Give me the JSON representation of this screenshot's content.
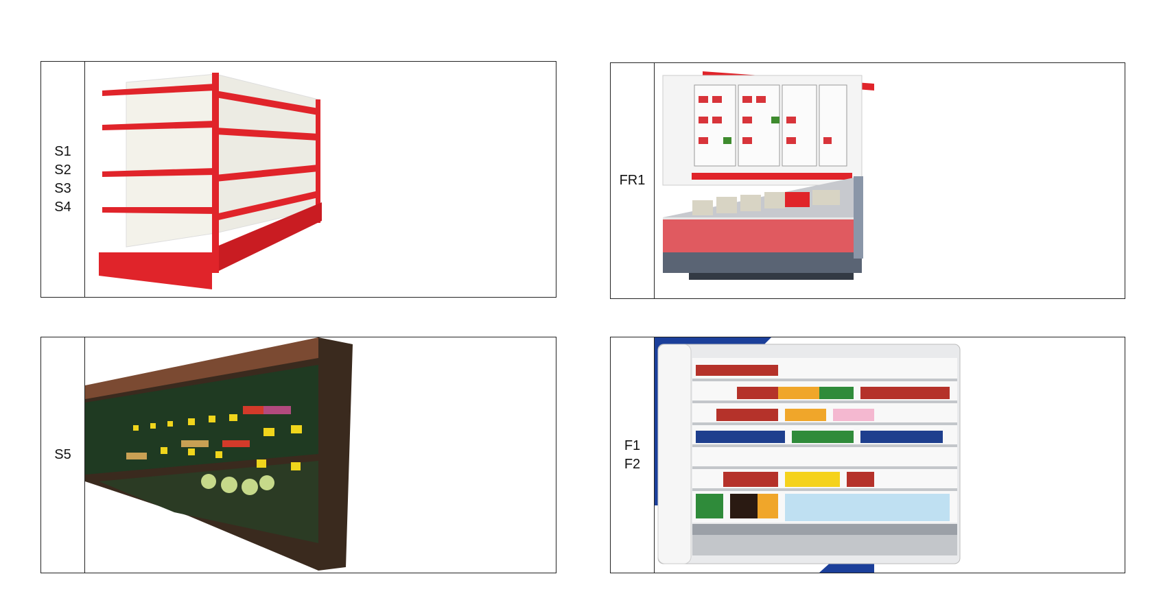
{
  "panels": [
    {
      "id": "gondola-shelf",
      "labels": [
        "S1",
        "S2",
        "S3",
        "S4"
      ],
      "image_icon": "gondola-shelving-icon",
      "accent": "#e0242a"
    },
    {
      "id": "freezer",
      "labels": [
        "FR1"
      ],
      "image_icon": "combination-freezer-icon",
      "accent": "#e0242a"
    },
    {
      "id": "produce-rack",
      "labels": [
        "S5"
      ],
      "image_icon": "produce-display-icon",
      "accent": "#5a2c1e"
    },
    {
      "id": "open-chiller",
      "labels": [
        "F1",
        "F2"
      ],
      "image_icon": "open-chiller-icon",
      "accent": "#1b3f9a"
    }
  ]
}
